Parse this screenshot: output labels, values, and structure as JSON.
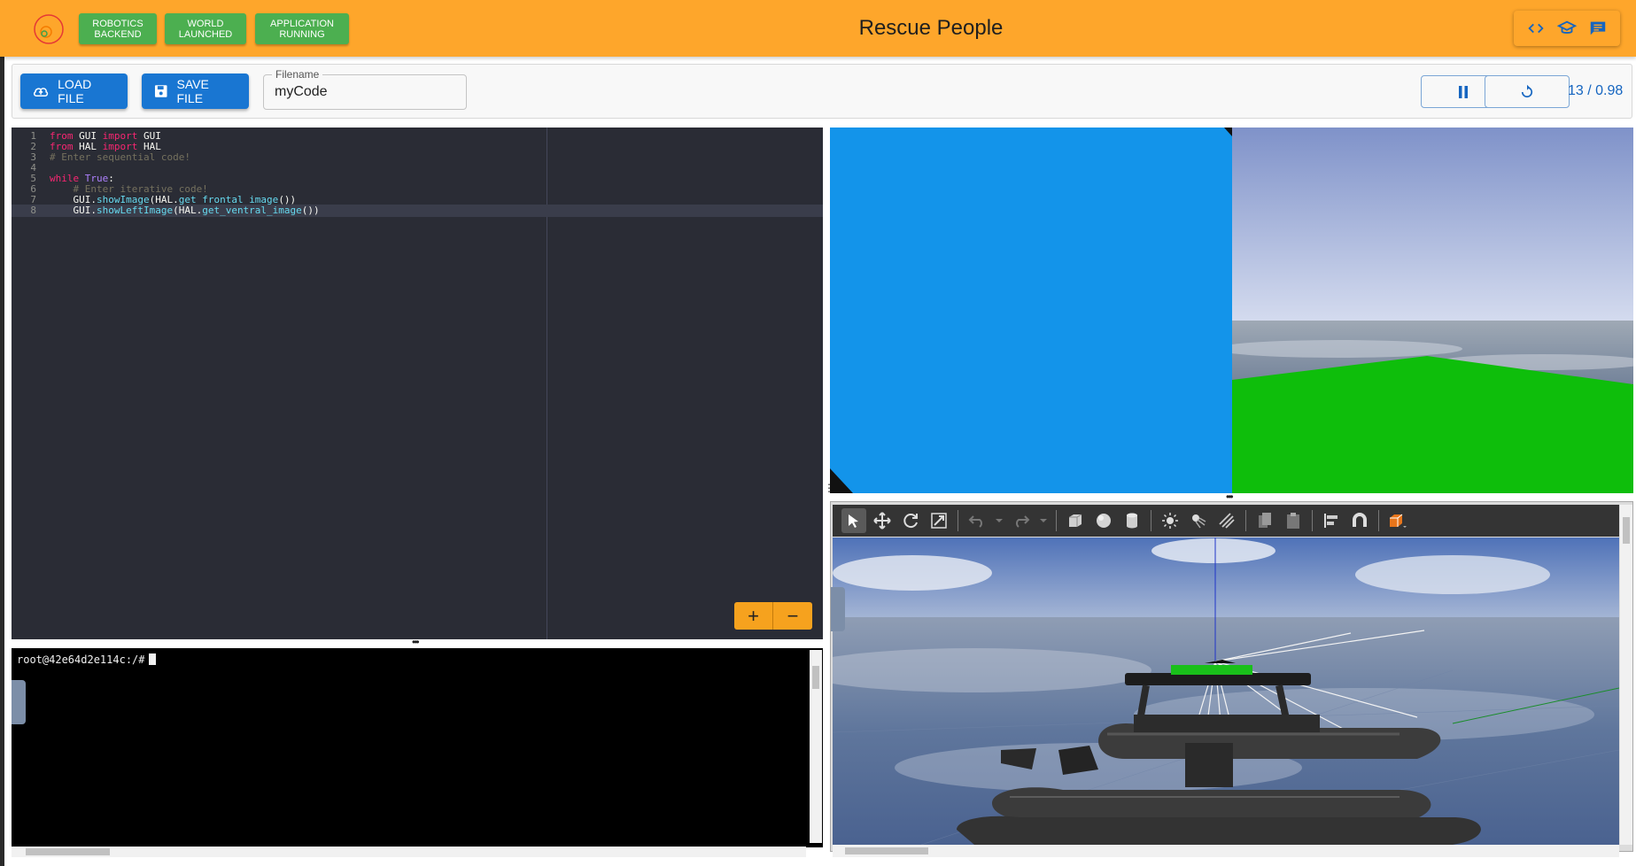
{
  "header": {
    "title": "Rescue People",
    "status": [
      {
        "line1": "ROBOTICS",
        "line2": "BACKEND"
      },
      {
        "line1": "WORLD",
        "line2": "LAUNCHED"
      },
      {
        "line1": "APPLICATION",
        "line2": "RUNNING"
      }
    ],
    "tools": [
      "code-icon",
      "school-icon",
      "forum-icon"
    ],
    "colors": {
      "bar": "#fea62b",
      "status_ok": "#4caf50"
    }
  },
  "toolbar": {
    "load_label": "LOAD FILE",
    "save_label": "SAVE FILE",
    "filename_label": "Filename",
    "filename_value": "myCode",
    "rtf": "13 / 0.98"
  },
  "editor": {
    "lines": [
      {
        "n": "1",
        "text": "from GUI import GUI"
      },
      {
        "n": "2",
        "text": "from HAL import HAL"
      },
      {
        "n": "3",
        "text": "# Enter sequential code!"
      },
      {
        "n": "4",
        "text": ""
      },
      {
        "n": "5",
        "text": "while True:"
      },
      {
        "n": "6",
        "text": "    # Enter iterative code!"
      },
      {
        "n": "7",
        "text": "    GUI.showImage(HAL.get_frontal_image())"
      },
      {
        "n": "8",
        "text": "    GUI.showLeftImage(HAL.get_ventral_image())"
      }
    ],
    "active_line": 8,
    "zoom_in": "+",
    "zoom_out": "−"
  },
  "terminal": {
    "prompt": "root@42e64d2e114c:/#"
  }
}
